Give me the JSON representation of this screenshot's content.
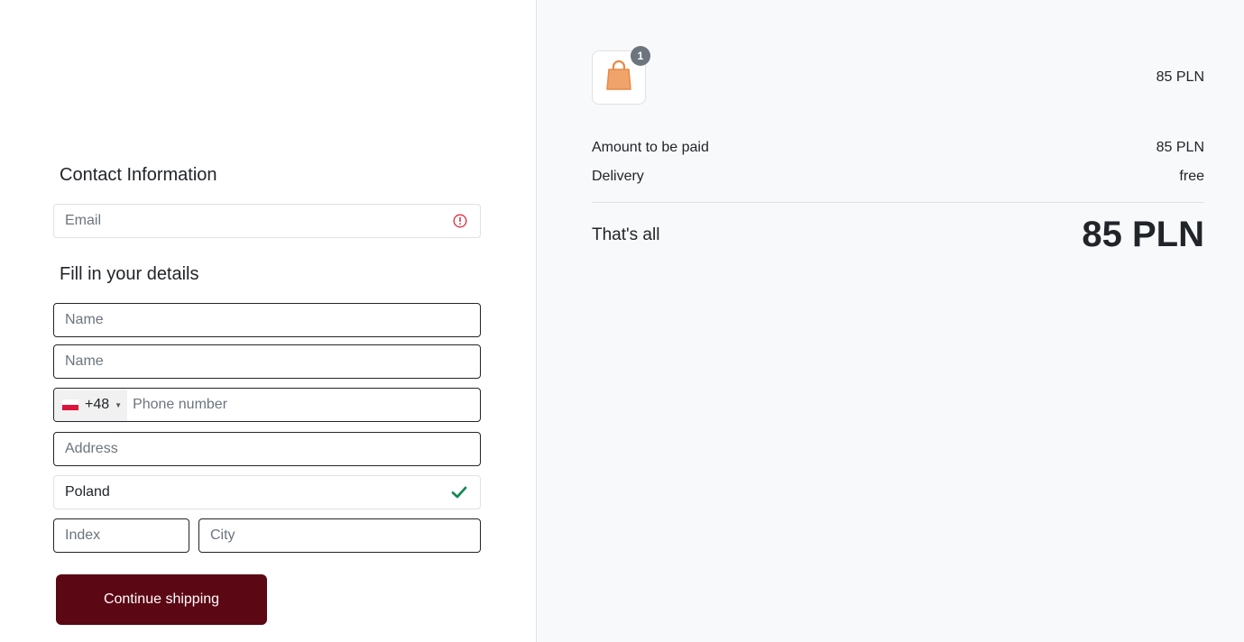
{
  "contact": {
    "heading": "Contact Information",
    "email_placeholder": "Email",
    "email_status_icon": "alert-circle-icon"
  },
  "details": {
    "heading": "Fill in your details",
    "first_name_placeholder": "Name",
    "last_name_placeholder": "Name",
    "phone": {
      "country_flag": "poland-flag",
      "country_code": "+48",
      "placeholder": "Phone number"
    },
    "address_placeholder": "Address",
    "country_value": "Poland",
    "country_status_icon": "check-icon",
    "index_placeholder": "Index",
    "city_placeholder": "City"
  },
  "actions": {
    "continue_label": "Continue shipping"
  },
  "summary": {
    "item": {
      "icon": "shopping-bag-icon",
      "quantity": "1",
      "price": "85 PLN"
    },
    "amount_label": "Amount to be paid",
    "amount_value": "85 PLN",
    "delivery_label": "Delivery",
    "delivery_value": "free",
    "total_label": "That's all",
    "total_value": "85 PLN"
  },
  "colors": {
    "primary": "#5c0714",
    "error": "#dc3545",
    "success": "#198754",
    "bag": "#f0a46c"
  }
}
